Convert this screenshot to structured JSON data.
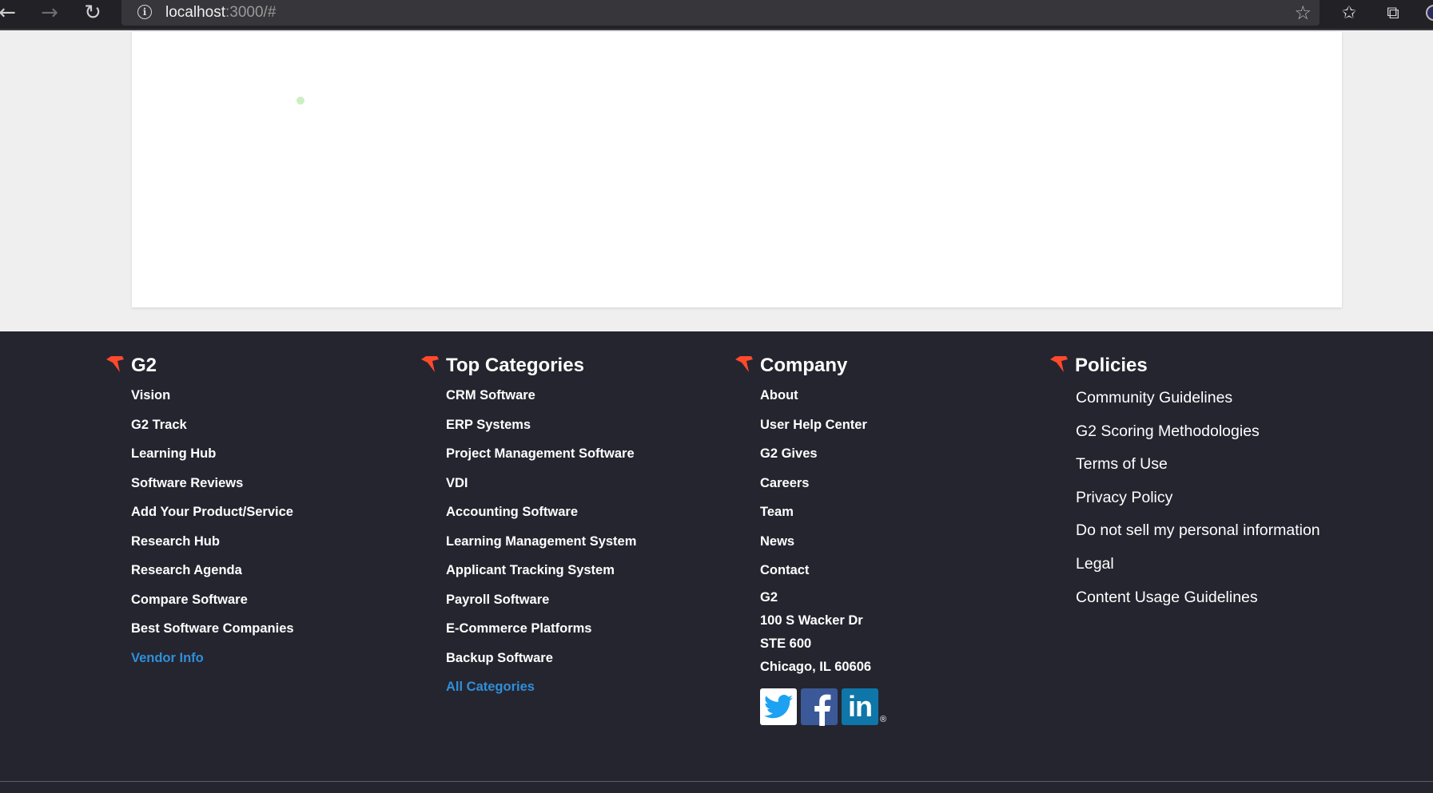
{
  "browser": {
    "back_icon": "arrow-left-icon",
    "forward_icon": "arrow-right-icon",
    "reload_icon": "reload-icon",
    "url_host": "localhost",
    "url_rest": ":3000/#"
  },
  "footer": {
    "columns": [
      {
        "title": "G2",
        "links": [
          "Vision",
          "G2 Track",
          "Learning Hub",
          "Software Reviews",
          "Add Your Product/Service",
          "Research Hub",
          "Research Agenda",
          "Compare Software",
          "Best Software Companies"
        ],
        "accent_link": "Vendor Info"
      },
      {
        "title": "Top Categories",
        "links": [
          "CRM Software",
          "ERP Systems",
          "Project Management Software",
          "VDI",
          "Accounting Software",
          "Learning Management System",
          "Applicant Tracking System",
          "Payroll Software",
          "E-Commerce Platforms",
          "Backup Software"
        ],
        "accent_link": "All Categories"
      },
      {
        "title": "Company",
        "links": [
          "About",
          "User Help Center",
          "G2 Gives",
          "Careers",
          "Team",
          "News",
          "Contact"
        ],
        "address": [
          "G2",
          "100 S Wacker Dr",
          "STE 600",
          "Chicago, IL 60606"
        ],
        "social": {
          "linkedin_text": "in",
          "registered": "®"
        }
      },
      {
        "title": "Policies",
        "links": [
          "Community Guidelines",
          "G2 Scoring Methodologies",
          "Terms of Use",
          "Privacy Policy",
          "Do not sell my personal information",
          "Legal",
          "Content Usage Guidelines"
        ]
      }
    ]
  },
  "colors": {
    "footer_bg": "#252530",
    "accent_link": "#2f8fd8",
    "brand_red": "#ff492c"
  }
}
